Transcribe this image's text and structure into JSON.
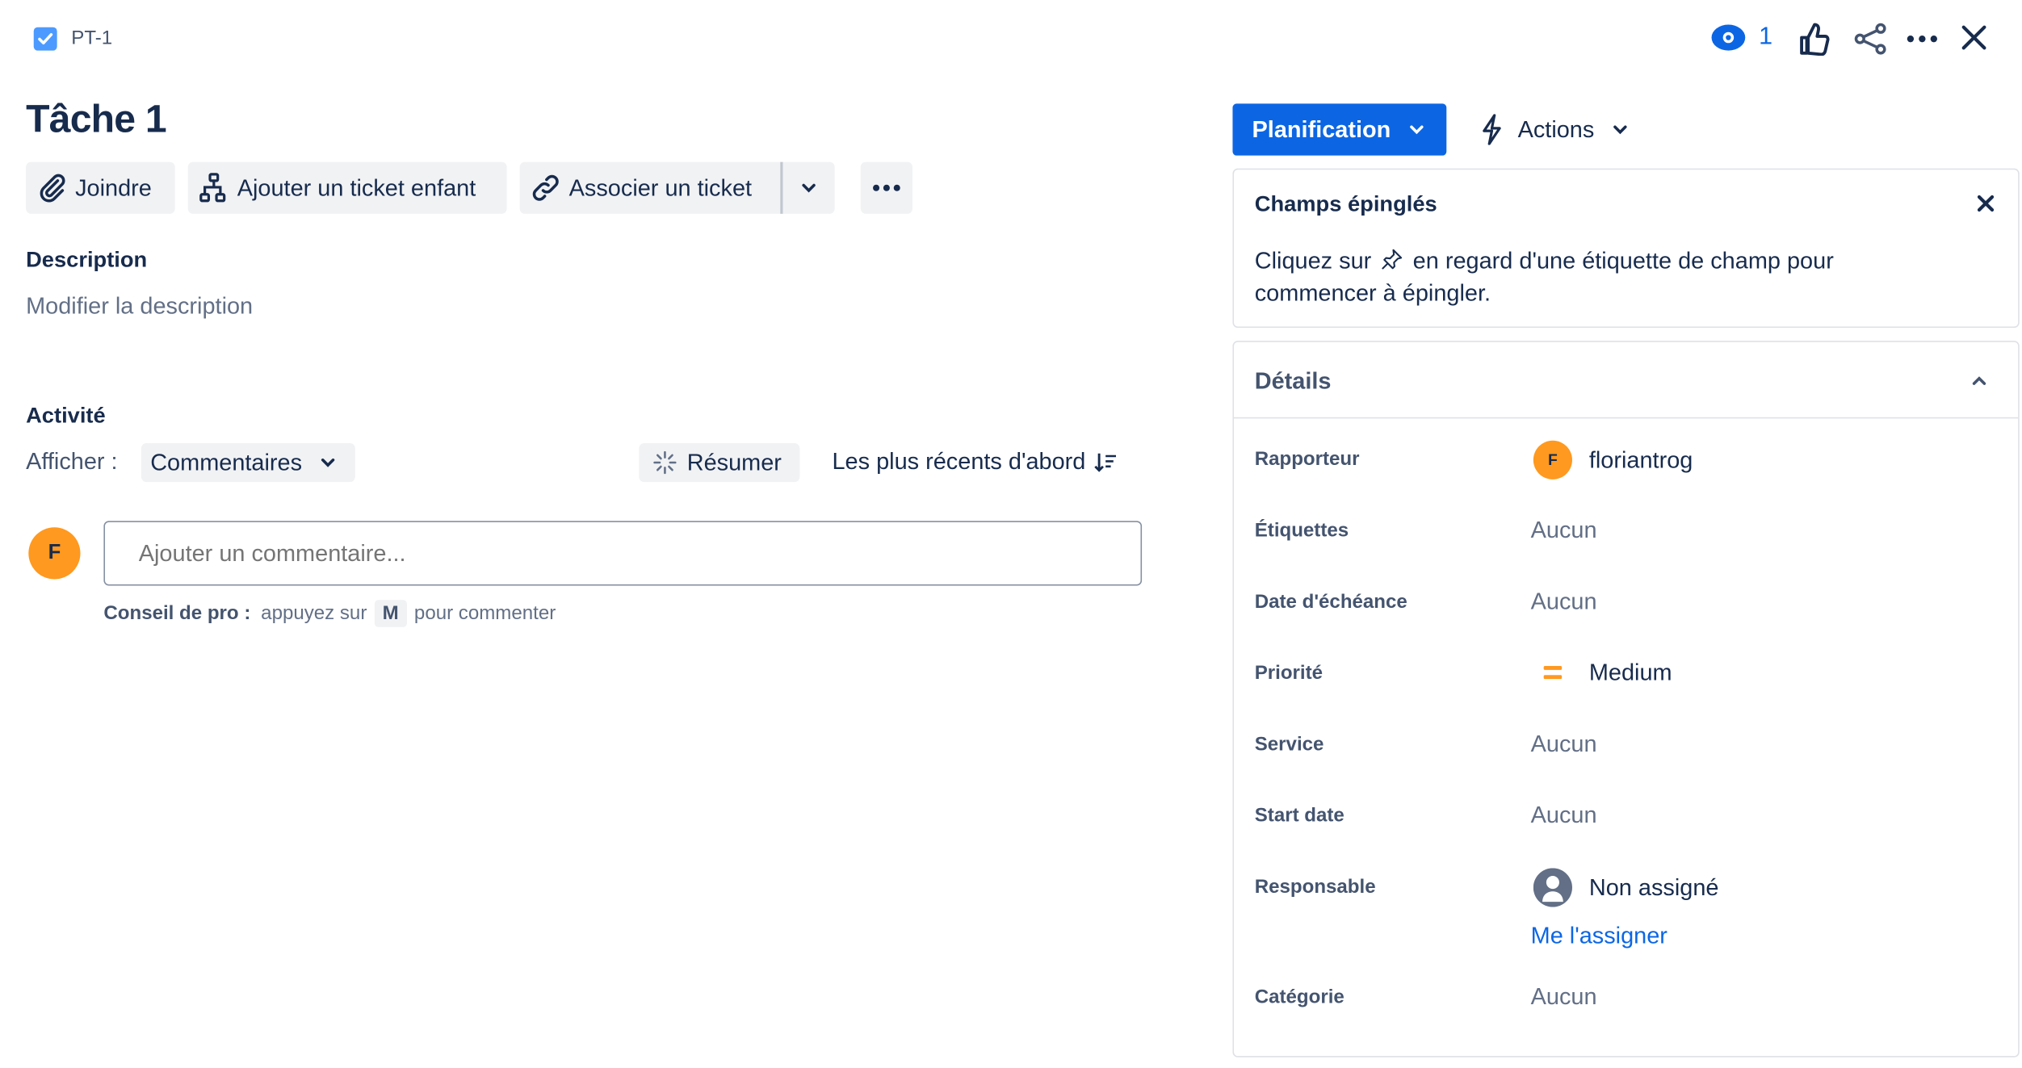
{
  "header": {
    "issue_key": "PT-1",
    "watch_count": "1",
    "title": "Tâche 1"
  },
  "toolbar": {
    "attach_label": "Joindre",
    "add_child_label": "Ajouter un ticket enfant",
    "link_issue_label": "Associer un ticket"
  },
  "description": {
    "heading": "Description",
    "placeholder": "Modifier la description"
  },
  "activity": {
    "heading": "Activité",
    "show_label": "Afficher :",
    "show_value": "Commentaires",
    "summarize_label": "Résumer",
    "sort_label": "Les plus récents d'abord",
    "avatar_initial": "F",
    "comment_placeholder": "Ajouter un commentaire...",
    "tip_bold": "Conseil de pro :",
    "tip_before": "appuyez sur",
    "tip_key": "M",
    "tip_after": "pour commenter"
  },
  "right": {
    "status_button": "Planification",
    "actions_button": "Actions",
    "pinned": {
      "title": "Champs épinglés",
      "text_before": "Cliquez sur",
      "text_after": "en regard d'une étiquette de champ pour",
      "text_line2": "commencer à épingler."
    },
    "details": {
      "title": "Détails",
      "fields": [
        {
          "label": "Rapporteur",
          "value": "floriantrog",
          "avatar": "F"
        },
        {
          "label": "Étiquettes",
          "value": "Aucun"
        },
        {
          "label": "Date d'échéance",
          "value": "Aucun"
        },
        {
          "label": "Priorité",
          "value": "Medium"
        },
        {
          "label": "Service",
          "value": "Aucun"
        },
        {
          "label": "Start date",
          "value": "Aucun"
        },
        {
          "label": "Responsable",
          "value": "Non assigné",
          "action": "Me l'assigner"
        },
        {
          "label": "Catégorie",
          "value": "Aucun"
        }
      ]
    }
  },
  "colors": {
    "primary": "#0c66e4",
    "avatar": "#ff991f",
    "priority_medium": "#ff991f"
  }
}
